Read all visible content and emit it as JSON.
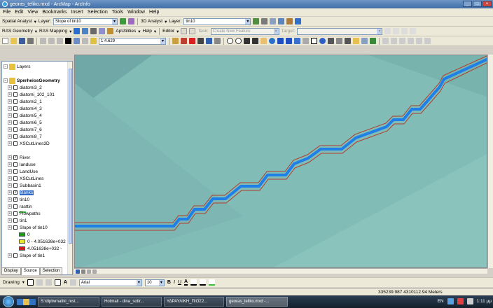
{
  "window": {
    "title": "georas_teliko.mxd - ArcMap - ArcInfo"
  },
  "menu": [
    "File",
    "Edit",
    "View",
    "Bookmarks",
    "Insert",
    "Selection",
    "Tools",
    "Window",
    "Help"
  ],
  "toolbar1": {
    "spatial_analyst": "Spatial Analyst",
    "layer_label": "Layer:",
    "spatial_layer": "Slope of tin10",
    "analyst3d": "3D Analyst",
    "layer_label2": "Layer:",
    "analyst_layer": "tin10"
  },
  "toolbar2": {
    "ras_geometry": "RAS Geometry",
    "ras_mapping": "RAS Mapping",
    "aputilities": "ApUtilities",
    "help": "Help",
    "editor": "Editor",
    "task_label": "Task:",
    "task_value": "Create New Feature",
    "target_label": "Target:",
    "target_value": ""
  },
  "toolbar3": {
    "scale": "1:4.629"
  },
  "toc": {
    "layers_label": "Layers",
    "group": "SperheiosGeometry",
    "items": [
      {
        "name": "diatomi3_2",
        "checked": false
      },
      {
        "name": "diatomi_102_101",
        "checked": false
      },
      {
        "name": "diatomi2_1",
        "checked": false
      },
      {
        "name": "diatomi4_3",
        "checked": false
      },
      {
        "name": "diatomi5_4",
        "checked": false
      },
      {
        "name": "diatomi6_5",
        "checked": false
      },
      {
        "name": "diatomi7_6",
        "checked": false
      },
      {
        "name": "diatomi8_7",
        "checked": false
      },
      {
        "name": "XSCutLines3D",
        "checked": false
      },
      {
        "name": "River",
        "checked": true
      },
      {
        "name": "landuse",
        "checked": false
      },
      {
        "name": "LandUse",
        "checked": false
      },
      {
        "name": "XSCutLines",
        "checked": false
      },
      {
        "name": "Subbasin1",
        "checked": false
      },
      {
        "name": "Banks",
        "checked": true,
        "selected": true
      },
      {
        "name": "tin10",
        "checked": true
      },
      {
        "name": "rasttin",
        "checked": false
      },
      {
        "name": "Flowpaths",
        "checked": false
      },
      {
        "name": "tin1",
        "checked": false
      },
      {
        "name": "Slope of tin10",
        "checked": false
      }
    ],
    "legend": [
      {
        "label": "0",
        "color": "#1a9a1a"
      },
      {
        "label": "0 - 4.051638e+032",
        "color": "#e8e82a"
      },
      {
        "label": "4.051638e+032 -",
        "color": "#c8201c"
      }
    ],
    "after": [
      {
        "name": "Slope of tin1",
        "checked": false
      }
    ],
    "tabs": [
      "Display",
      "Source",
      "Selection"
    ]
  },
  "drawing": {
    "drawing_label": "Drawing",
    "font": "Arial",
    "size": "10",
    "bold": "B",
    "italic": "I",
    "underline": "U"
  },
  "status": {
    "coords": "335239.987  4310112.94 Meters"
  },
  "taskbar": {
    "tasks": [
      "S:\\diplwmatiki_mst...",
      "Hotmail - dina_sotir...",
      "ΥΔΡΑΥΛΙΚΗ_ΠΙΟΣ2...",
      "georas_teliko.mxd -..."
    ],
    "lang": "EN",
    "time": "1:11 μμ"
  },
  "colors": {
    "map_bg": "#82bcb6",
    "river": "#1f7fe8",
    "banks": "#b03c2c"
  }
}
